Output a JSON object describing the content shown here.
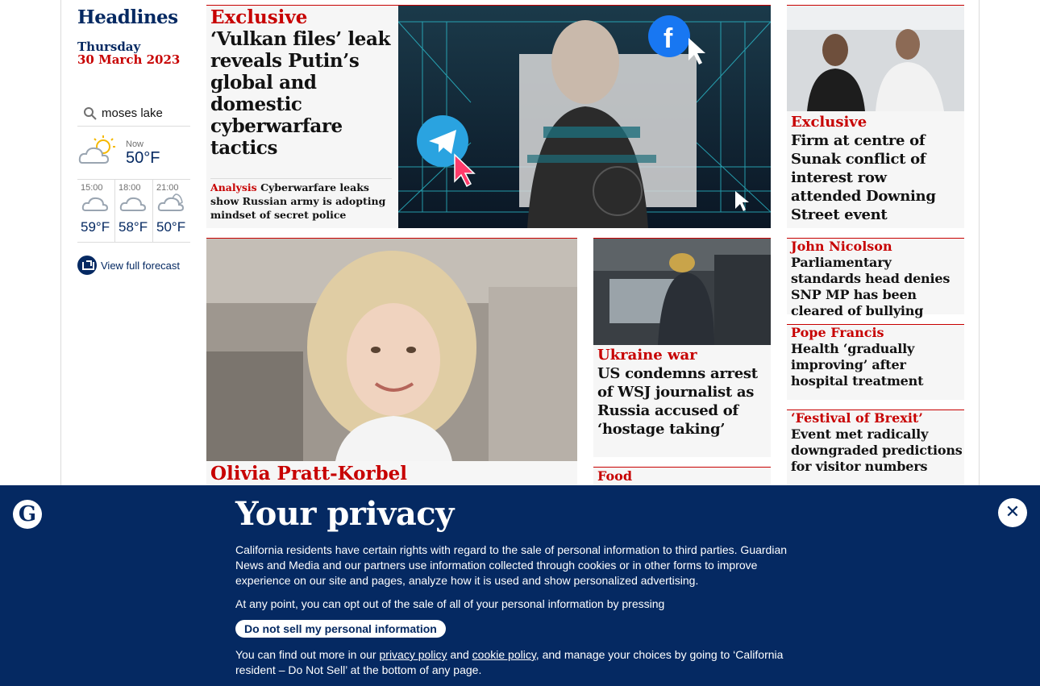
{
  "sidebar": {
    "title": "Headlines",
    "day": "Thursday",
    "date": "30 March 2023",
    "location_value": "moses lake",
    "now_label": "Now",
    "now_temp": "50°F",
    "forecast": [
      {
        "time": "15:00",
        "temp": "59°F"
      },
      {
        "time": "18:00",
        "temp": "58°F"
      },
      {
        "time": "21:00",
        "temp": "50°F"
      }
    ],
    "full_forecast_label": "View full forecast"
  },
  "main_story": {
    "kicker": "Exclusive",
    "headline": "‘Vulkan files’ leak reveals Putin’s global and domestic cyberwarfare tactics",
    "sublink_kicker": "Analysis",
    "sublink_text": " Cyberwarfare leaks show Russian army is adopting mindset of secret police"
  },
  "right_top": {
    "kicker": "Exclusive",
    "headline": "Firm at centre of Sunak conflict of interest row attended Downing Street event"
  },
  "olivia": {
    "kicker": "Olivia Pratt-Korbel"
  },
  "ukraine": {
    "kicker": "Ukraine war",
    "headline": "US condemns arrest of WSJ journalist as Russia accused of ‘hostage taking’"
  },
  "food": {
    "kicker": "Food"
  },
  "side_stories": [
    {
      "kicker": "John Nicolson",
      "headline": "Parliamentary standards head denies SNP MP has been cleared of bullying"
    },
    {
      "kicker": "Pope Francis",
      "headline": "Health ‘gradually improving’ after hospital treatment"
    },
    {
      "kicker": "‘Festival of Brexit’",
      "headline": "Event met radically downgraded predictions for visitor numbers"
    }
  ],
  "privacy": {
    "title": "Your privacy",
    "para1": "California residents have certain rights with regard to the sale of personal information to third parties. Guardian News and Media and our partners use information collected through cookies or in other forms to improve experience on our site and pages, analyze how it is used and show personalized advertising.",
    "para2": "At any point, you can opt out of the sale of all of your personal information by pressing",
    "button": "Do not sell my personal information",
    "para3_a": "You can find out more in our ",
    "privacy_link": "privacy policy",
    "para3_b": " and ",
    "cookie_link": "cookie policy",
    "para3_c": ", and manage your choices by going to ‘California resident – Do Not Sell’ at the bottom of any page.",
    "close_glyph": "✕",
    "logo_glyph": "G"
  }
}
